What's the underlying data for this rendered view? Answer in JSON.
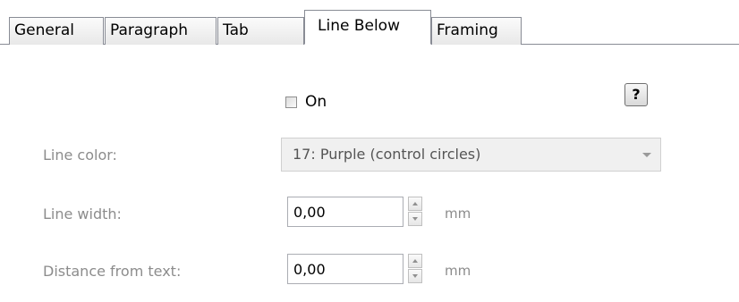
{
  "tabs": [
    {
      "label": "General",
      "active": false
    },
    {
      "label": "Paragraph",
      "active": false
    },
    {
      "label": "Tab",
      "active": false
    },
    {
      "label": "Line Below",
      "active": true
    },
    {
      "label": "Framing",
      "active": false
    }
  ],
  "on_checkbox": {
    "label": "On",
    "checked": false
  },
  "help_button": {
    "label": "?"
  },
  "line_color": {
    "label": "Line color:",
    "value": "17: Purple (control circles)"
  },
  "line_width": {
    "label": "Line width:",
    "value": "0,00",
    "unit": "mm"
  },
  "distance_from_text": {
    "label": "Distance from text:",
    "value": "0,00",
    "unit": "mm"
  },
  "colors": {
    "tab_border": "#898c95",
    "disabled_text": "#8c8c8c",
    "combo_background": "#f0f0f0"
  }
}
